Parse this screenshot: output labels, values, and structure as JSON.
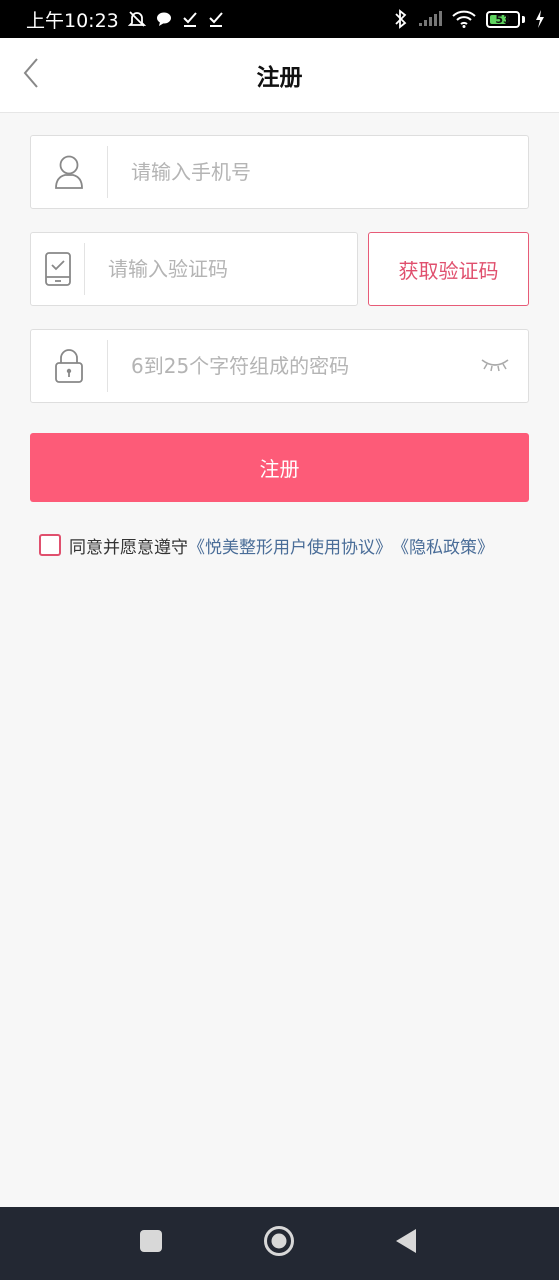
{
  "status_bar": {
    "time": "上午10:23",
    "battery": "53",
    "battery_level": 0.53,
    "icons": [
      "mute-icon",
      "message-icon",
      "check-icon",
      "check-icon",
      "bluetooth-icon",
      "signal-icon",
      "wifi-icon",
      "battery-icon",
      "charging-icon"
    ]
  },
  "header": {
    "title": "注册",
    "back_icon": "chevron-left-icon"
  },
  "form": {
    "phone": {
      "placeholder": "请输入手机号",
      "value": "",
      "icon": "user-icon"
    },
    "code": {
      "placeholder": "请输入验证码",
      "value": "",
      "icon": "phone-check-icon"
    },
    "get_code_label": "获取验证码",
    "password": {
      "placeholder": "6到25个字符组成的密码",
      "value": "",
      "icon": "lock-icon",
      "toggle_icon": "eye-closed-icon"
    },
    "submit_label": "注册"
  },
  "agreement": {
    "checked": false,
    "prefix": "同意并愿意遵守",
    "user_agreement": "《悦美整形用户使用协议》",
    "privacy_policy": "《隐私政策》"
  },
  "colors": {
    "accent": "#fd5b78",
    "accent_border": "#e75b77",
    "link": "#4a6d98",
    "background": "#f7f7f7"
  },
  "system_nav": {
    "icons": [
      "square-icon",
      "circle-icon",
      "triangle-back-icon"
    ]
  }
}
